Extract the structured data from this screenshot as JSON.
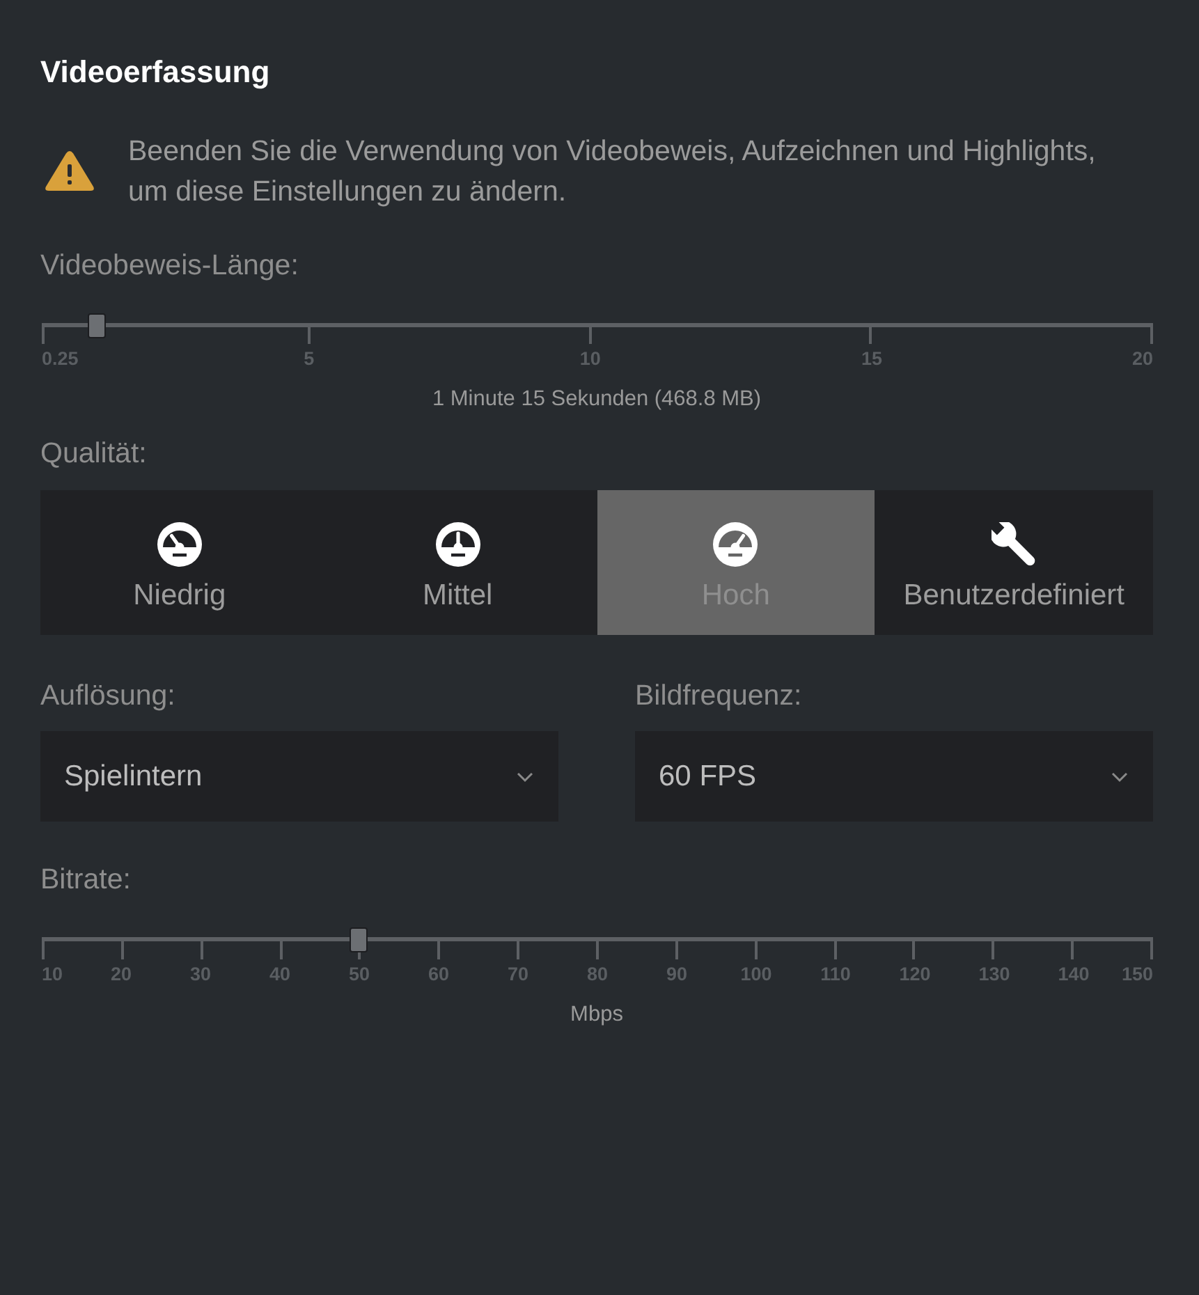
{
  "title": "Videoerfassung",
  "warning": {
    "text": "Beenden Sie die Verwendung von Videobeweis, Aufzeichnen und Highlights, um diese Einstellungen zu ändern."
  },
  "replay_length": {
    "label": "Videobeweis-Länge:",
    "level": 0.05,
    "ticks": [
      "0.25",
      "5",
      "10",
      "15",
      "20"
    ],
    "caption": "1 Minute 15 Sekunden (468.8 MB)"
  },
  "quality": {
    "label": "Qualität:",
    "options": [
      {
        "label": "Niedrig",
        "kind": "gauge",
        "selected": false
      },
      {
        "label": "Mittel",
        "kind": "gauge",
        "selected": false
      },
      {
        "label": "Hoch",
        "kind": "gauge",
        "selected": true
      },
      {
        "label": "Benutzerdefiniert",
        "kind": "wrench",
        "selected": false
      }
    ]
  },
  "resolution": {
    "label": "Auflösung:",
    "value": "Spielintern"
  },
  "frame_rate": {
    "label": "Bildfrequenz:",
    "value": "60 FPS"
  },
  "bitrate": {
    "label": "Bitrate:",
    "level": 0.2857,
    "ticks": [
      "10",
      "20",
      "30",
      "40",
      "50",
      "60",
      "70",
      "80",
      "90",
      "100",
      "110",
      "120",
      "130",
      "140",
      "150"
    ],
    "caption": "Mbps"
  }
}
